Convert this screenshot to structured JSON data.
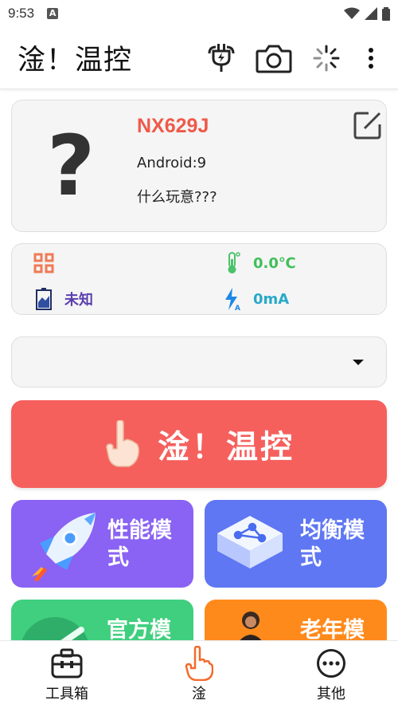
{
  "status_bar": {
    "time": "9:53",
    "notification_icon": "A"
  },
  "app_bar": {
    "title": "淦！温控",
    "actions": [
      "plug-icon",
      "camera-icon",
      "loading-icon",
      "more-vert-icon"
    ]
  },
  "device": {
    "image_placeholder": "?",
    "name": "NX629J",
    "android": "Android:9",
    "description": "什么玩意???"
  },
  "stats": {
    "grid_value": "",
    "temperature": "0.0℃",
    "battery_status": "未知",
    "current": "0mA"
  },
  "mode_select": {
    "selected": ""
  },
  "main_button": {
    "label": "淦！温控"
  },
  "tiles": [
    {
      "label": "性能模式",
      "line1": "性能模",
      "line2": "式"
    },
    {
      "label": "均衡模式",
      "line1": "均衡模",
      "line2": "式"
    },
    {
      "label": "官方模式",
      "line1": "官方模",
      "line2": ""
    },
    {
      "label": "老年模式",
      "line1": "老年模",
      "line2": ""
    }
  ],
  "bottom_nav": {
    "items": [
      {
        "label": "工具箱",
        "icon": "toolbox-icon"
      },
      {
        "label": "淦",
        "icon": "hand-icon"
      },
      {
        "label": "其他",
        "icon": "more-horiz-icon"
      }
    ],
    "selected": 1
  },
  "colors": {
    "device_name": "#ee5a4a",
    "temperature": "#3fbf5a",
    "battery": "#5b3fae",
    "current": "#29a9c9",
    "main_button": "#f5605d",
    "tile_perf": "#8a62f4",
    "tile_balance": "#5f77f2",
    "tile_official": "#3fcf7e",
    "tile_old": "#ff8a1c",
    "nav_active": "#f36a2b"
  }
}
